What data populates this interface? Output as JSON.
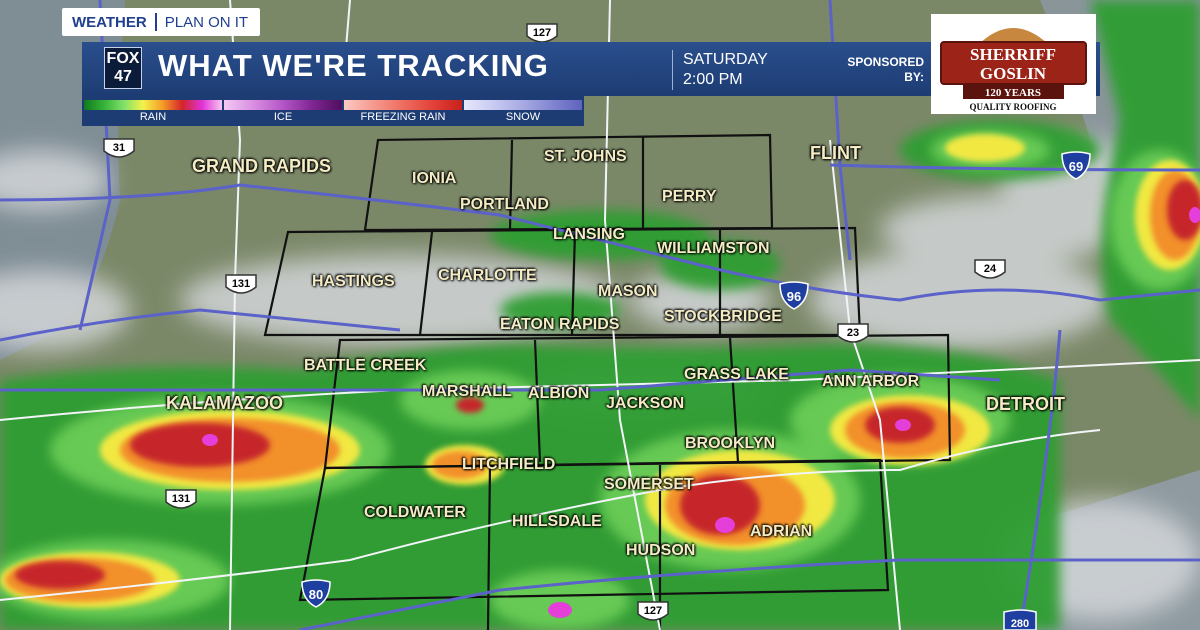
{
  "header": {
    "tag_left": "WEATHER",
    "tag_right": "PLAN ON IT",
    "station_logo_top": "FOX",
    "station_logo_bottom": "47",
    "title": "WHAT WE'RE TRACKING",
    "day": "SATURDAY",
    "time": "2:00 PM",
    "sponsored_line1": "SPONSORED",
    "sponsored_line2": "BY:"
  },
  "sponsor": {
    "name_line1": "SHERRIFF",
    "name_line2": "GOSLIN",
    "anniversary": "120 YEARS",
    "tagline": "QUALITY ROOFING"
  },
  "legend": [
    {
      "label": "RAIN",
      "colors": [
        "#0f7a1f",
        "#35b236",
        "#7ee06a",
        "#f4f24a",
        "#f59a28",
        "#d3242a",
        "#e033d8",
        "#f7c6f0"
      ]
    },
    {
      "label": "ICE",
      "colors": [
        "#f4c8f4",
        "#d98ee0",
        "#b455c7",
        "#7f2592",
        "#4e0f5e"
      ]
    },
    {
      "label": "FREEZING RAIN",
      "colors": [
        "#fbc9c2",
        "#f59a90",
        "#ef6d60",
        "#e2423a",
        "#c9201a"
      ]
    },
    {
      "label": "SNOW",
      "colors": [
        "#e6e7fb",
        "#c8caf1",
        "#a7aae3",
        "#8185d1",
        "#5f64bc"
      ]
    }
  ],
  "cities": [
    {
      "name": "GRAND RAPIDS",
      "size": "big"
    },
    {
      "name": "IONIA"
    },
    {
      "name": "ST. JOHNS"
    },
    {
      "name": "PORTLAND"
    },
    {
      "name": "PERRY"
    },
    {
      "name": "FLINT",
      "size": "big"
    },
    {
      "name": "LANSING"
    },
    {
      "name": "WILLIAMSTON"
    },
    {
      "name": "HASTINGS"
    },
    {
      "name": "CHARLOTTE"
    },
    {
      "name": "MASON"
    },
    {
      "name": "EATON RAPIDS"
    },
    {
      "name": "STOCKBRIDGE"
    },
    {
      "name": "BATTLE CREEK"
    },
    {
      "name": "MARSHALL"
    },
    {
      "name": "ALBION"
    },
    {
      "name": "GRASS LAKE"
    },
    {
      "name": "ANN ARBOR"
    },
    {
      "name": "JACKSON"
    },
    {
      "name": "DETROIT",
      "size": "big"
    },
    {
      "name": "KALAMAZOO",
      "size": "big"
    },
    {
      "name": "BROOKLYN"
    },
    {
      "name": "LITCHFIELD"
    },
    {
      "name": "SOMERSET"
    },
    {
      "name": "COLDWATER"
    },
    {
      "name": "HILLSDALE"
    },
    {
      "name": "ADRIAN"
    },
    {
      "name": "HUDSON"
    }
  ],
  "highways": [
    {
      "label": "31",
      "kind": "us"
    },
    {
      "label": "131",
      "kind": "us"
    },
    {
      "label": "131",
      "kind": "us"
    },
    {
      "label": "127",
      "kind": "us"
    },
    {
      "label": "127",
      "kind": "us"
    },
    {
      "label": "23",
      "kind": "us"
    },
    {
      "label": "24",
      "kind": "us"
    },
    {
      "label": "96",
      "kind": "interstate"
    },
    {
      "label": "69",
      "kind": "interstate"
    },
    {
      "label": "80",
      "kind": "interstate"
    },
    {
      "label": "280",
      "kind": "interstate"
    }
  ]
}
